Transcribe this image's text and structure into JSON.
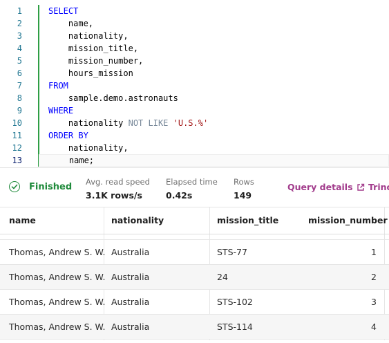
{
  "editor": {
    "line_numbers": [
      "1",
      "2",
      "3",
      "4",
      "5",
      "6",
      "7",
      "8",
      "9",
      "10",
      "11",
      "12",
      "13"
    ],
    "tokens": {
      "select": "SELECT",
      "col1": "    name,",
      "col2": "    nationality,",
      "col3": "    mission_title,",
      "col4": "    mission_number,",
      "col5": "    hours_mission",
      "from": "FROM",
      "table": "    sample.demo.astronauts",
      "where": "WHERE",
      "cond_col": "    nationality ",
      "cond_op": "NOT LIKE",
      "cond_val": "'U.S.%'",
      "order_by": "ORDER BY",
      "ob1": "    nationality,",
      "ob2": "    name;"
    }
  },
  "status": {
    "state": "Finished",
    "read_speed_label": "Avg. read speed",
    "read_speed_value": "3.1K rows/s",
    "elapsed_label": "Elapsed time",
    "elapsed_value": "0.42s",
    "rows_label": "Rows",
    "rows_value": "149",
    "query_details_label": "Query details",
    "trino_label": "Trino",
    "colors": {
      "success": "#1f8a3b",
      "link": "#a23c8c"
    }
  },
  "table": {
    "columns": [
      "name",
      "nationality",
      "mission_title",
      "mission_number"
    ],
    "rows": [
      [
        "Thomas, Andrew S. W.",
        "Australia",
        "STS-77",
        "1"
      ],
      [
        "Thomas, Andrew S. W.",
        "Australia",
        "24",
        "2"
      ],
      [
        "Thomas, Andrew S. W.",
        "Australia",
        "STS-102",
        "3"
      ],
      [
        "Thomas, Andrew S. W.",
        "Australia",
        "STS-114",
        "4"
      ]
    ]
  }
}
